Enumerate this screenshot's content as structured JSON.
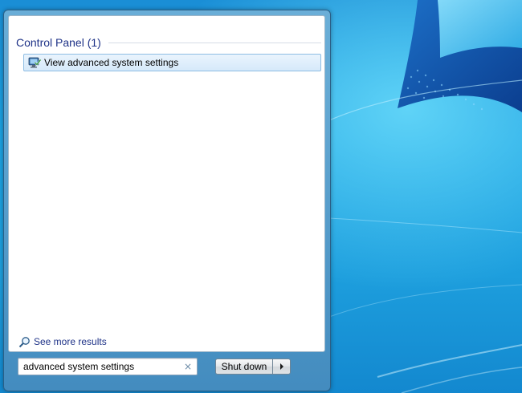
{
  "results": {
    "group_title": "Control Panel (1)",
    "items": [
      {
        "label": "View advanced system settings",
        "icon": "system-settings-icon"
      }
    ],
    "see_more_label": "See more results"
  },
  "search": {
    "value": "advanced system settings",
    "clear_glyph": "×"
  },
  "power": {
    "shutdown_label": "Shut down"
  },
  "colors": {
    "group_title": "#1e3287",
    "highlight_border": "#8ebde3",
    "desktop_blue": "#1ba2e2"
  }
}
